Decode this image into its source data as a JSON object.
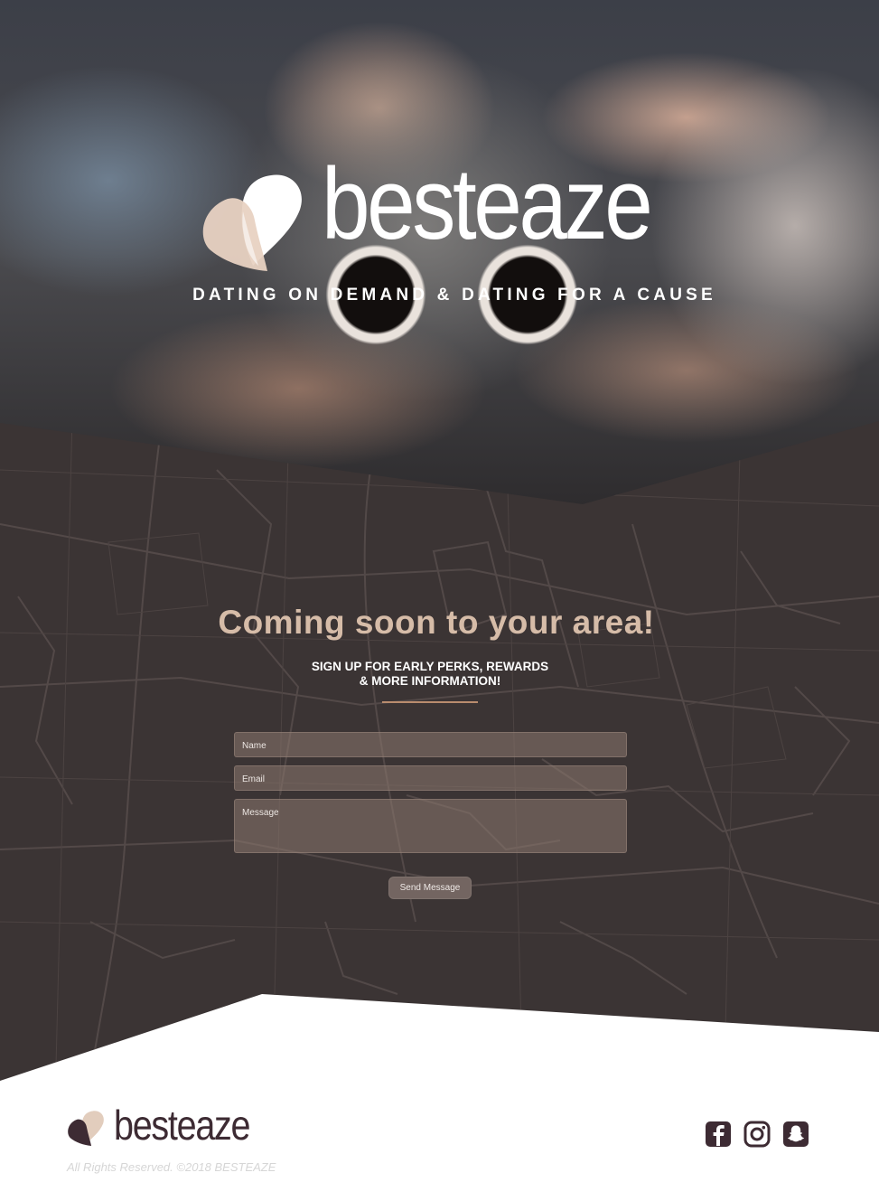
{
  "hero": {
    "brand": "besteaze",
    "tagline": "DATING ON DEMAND & DATING FOR A CAUSE"
  },
  "signup": {
    "headline": "Coming soon to your area!",
    "subhead_line1": "SIGN UP FOR EARLY PERKS, REWARDS",
    "subhead_line2": "& MORE INFORMATION!",
    "name_placeholder": "Name",
    "email_placeholder": "Email",
    "message_placeholder": "Message",
    "send_label": "Send Message"
  },
  "footer": {
    "brand": "besteaze",
    "copyright": "All Rights Reserved. ©2018 BESTEAZE",
    "social": [
      {
        "icon": "facebook-icon"
      },
      {
        "icon": "instagram-icon"
      },
      {
        "icon": "snapchat-icon"
      }
    ]
  },
  "colors": {
    "brand_dark": "#3d2b33",
    "accent_tan": "#d6bca8",
    "panel": "#3b3434"
  }
}
